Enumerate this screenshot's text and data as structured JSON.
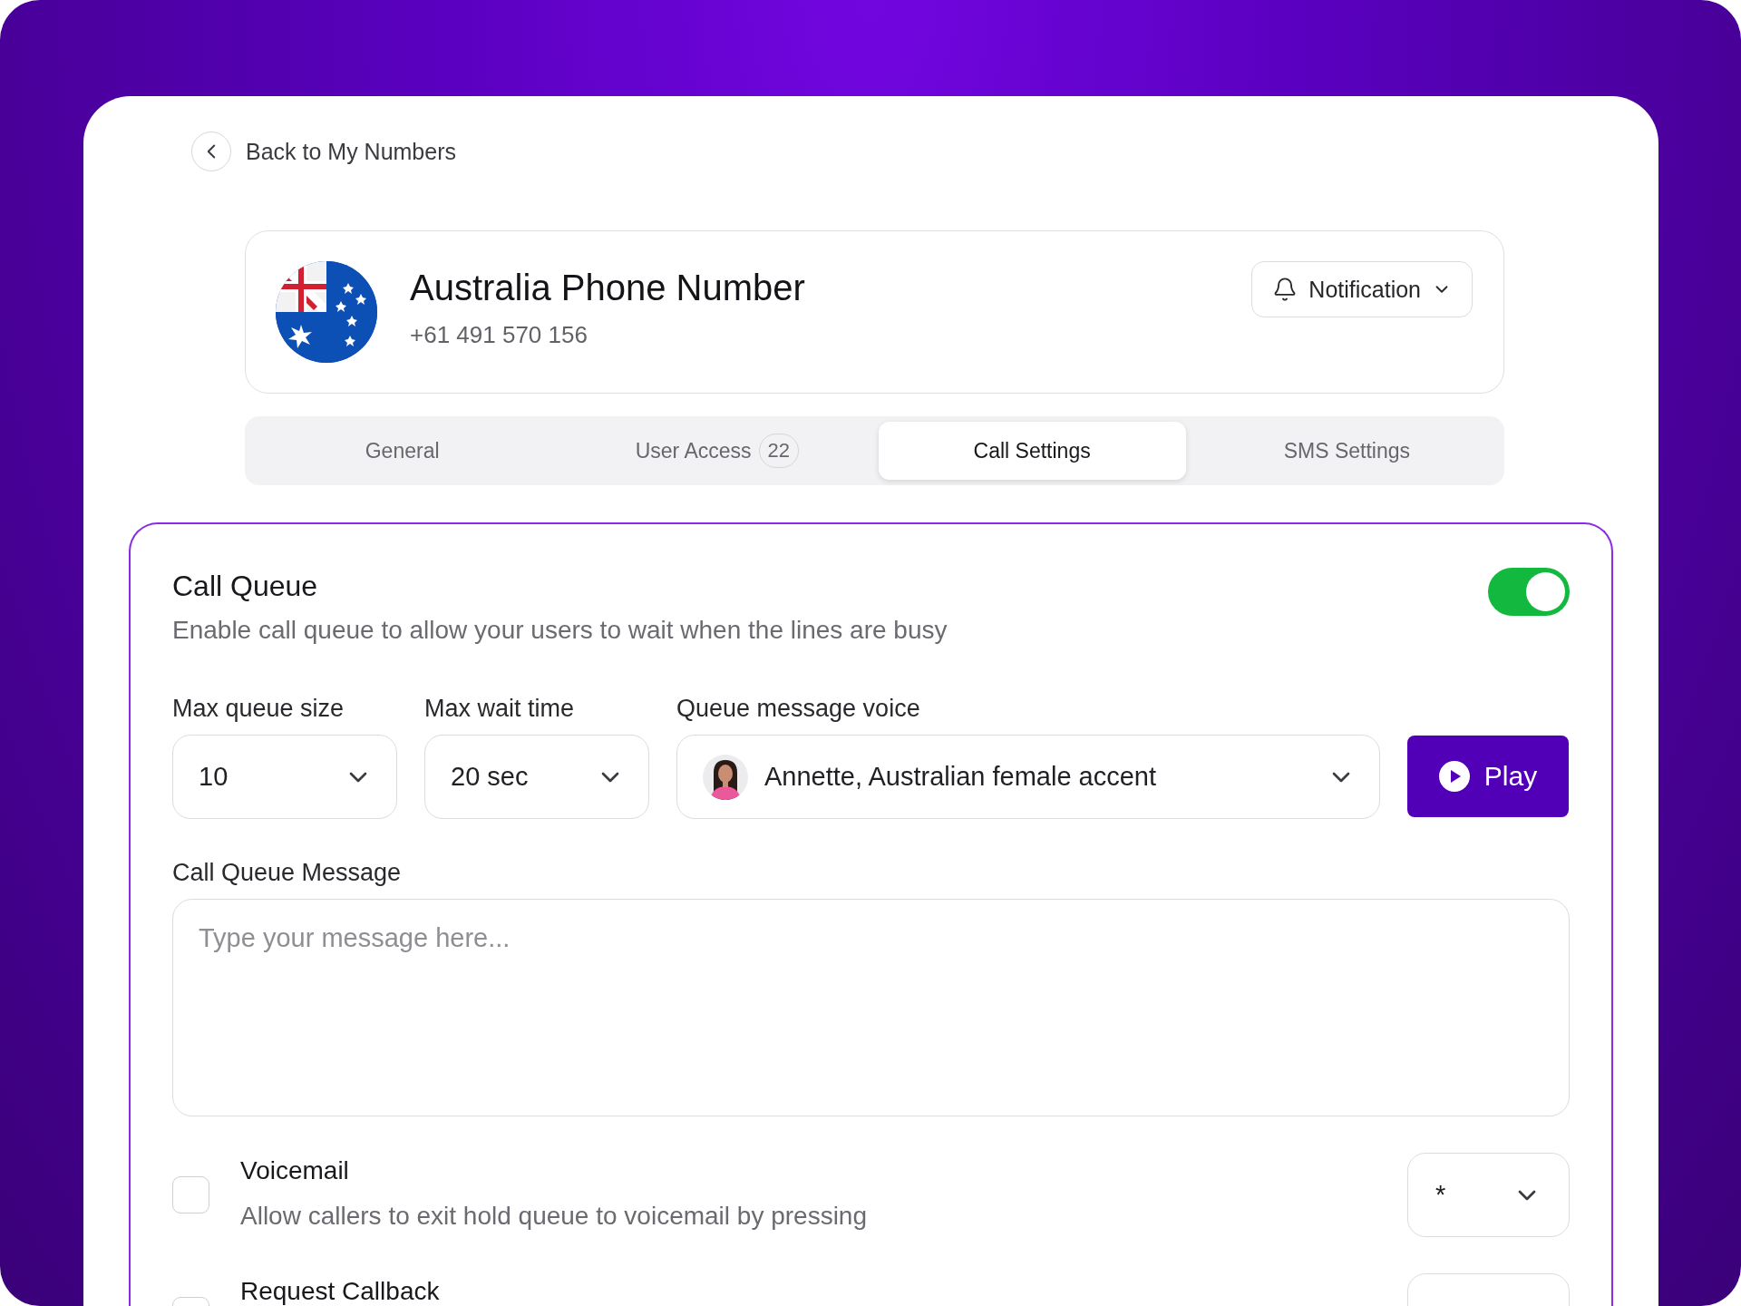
{
  "back_link": {
    "label": "Back to My Numbers"
  },
  "number": {
    "title": "Australia Phone Number",
    "phone": "+61 491 570 156"
  },
  "notification_button": {
    "label": "Notification"
  },
  "tabs": [
    {
      "label": "General",
      "selected": false
    },
    {
      "label": "User Access",
      "badge": "22",
      "selected": false
    },
    {
      "label": "Call Settings",
      "selected": true
    },
    {
      "label": "SMS Settings",
      "selected": false
    }
  ],
  "call_queue": {
    "title": "Call Queue",
    "description": "Enable call queue to allow your users to wait when the lines are busy",
    "on": true,
    "fields": [
      {
        "kind": "select",
        "label": "Max queue size",
        "value": "10"
      },
      {
        "kind": "select",
        "label": "Max wait time",
        "value": "20 sec"
      },
      {
        "kind": "voice",
        "label": "Queue message voice",
        "value": "Annette, Australian female accent"
      }
    ],
    "play_button": {
      "label": "Play"
    },
    "message": {
      "label": "Call Queue Message",
      "placeholder": "Type your message here..."
    },
    "options": [
      {
        "title": "Voicemail",
        "description": "Allow callers to exit hold queue to voicemail by pressing",
        "checked": false,
        "key": "*"
      },
      {
        "title": "Request Callback",
        "checked": false
      }
    ]
  }
}
